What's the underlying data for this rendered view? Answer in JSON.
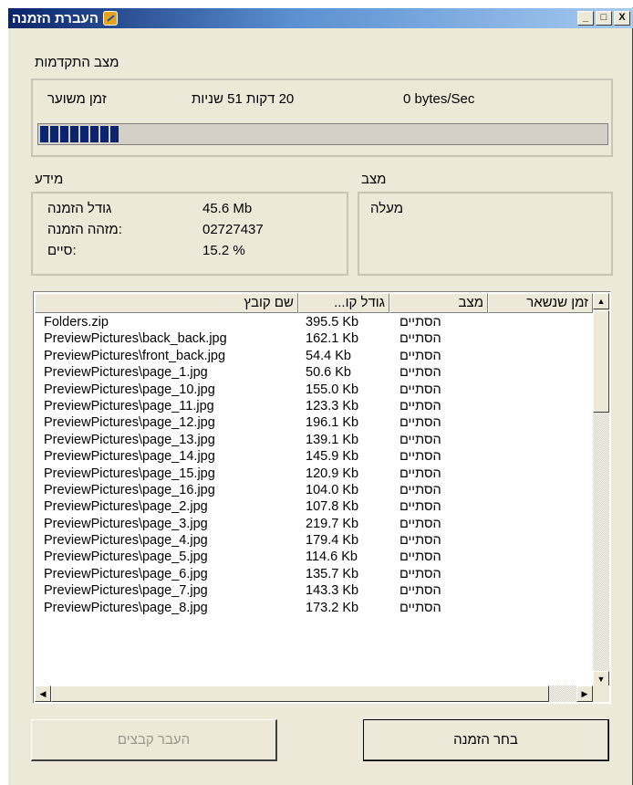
{
  "window": {
    "title": "העברת הזמנה",
    "caption_buttons": {
      "minimize": "_",
      "maximize": "□",
      "close": "X"
    }
  },
  "progress": {
    "section_label": "מצב התקדמות",
    "remaining_label": "זמן משוער",
    "remaining_value": "20 דקות 51 שניות",
    "speed": "0 bytes/Sec",
    "percent": 15.2
  },
  "info": {
    "section_label": "מידע",
    "fields": [
      {
        "label": "גודל הזמנה",
        "value": "45.6 Mb"
      },
      {
        "label": ":מזהה הזמנה",
        "value": "02727437"
      },
      {
        "label": ":סיים",
        "value": "15.2 %"
      }
    ]
  },
  "status": {
    "section_label": "מצב",
    "value": "מעלה"
  },
  "file_list": {
    "columns": [
      "שם קובץ",
      "גודל קו...",
      "מצב",
      "זמן שנשאר"
    ],
    "rows": [
      {
        "name": "Folders.zip",
        "size": "395.5 Kb",
        "status": "הסתיים"
      },
      {
        "name": "PreviewPictures\\back_back.jpg",
        "size": "162.1 Kb",
        "status": "הסתיים"
      },
      {
        "name": "PreviewPictures\\front_back.jpg",
        "size": "54.4 Kb",
        "status": "הסתיים"
      },
      {
        "name": "PreviewPictures\\page_1.jpg",
        "size": "50.6 Kb",
        "status": "הסתיים"
      },
      {
        "name": "PreviewPictures\\page_10.jpg",
        "size": "155.0 Kb",
        "status": "הסתיים"
      },
      {
        "name": "PreviewPictures\\page_11.jpg",
        "size": "123.3 Kb",
        "status": "הסתיים"
      },
      {
        "name": "PreviewPictures\\page_12.jpg",
        "size": "196.1 Kb",
        "status": "הסתיים"
      },
      {
        "name": "PreviewPictures\\page_13.jpg",
        "size": "139.1 Kb",
        "status": "הסתיים"
      },
      {
        "name": "PreviewPictures\\page_14.jpg",
        "size": "145.9 Kb",
        "status": "הסתיים"
      },
      {
        "name": "PreviewPictures\\page_15.jpg",
        "size": "120.9 Kb",
        "status": "הסתיים"
      },
      {
        "name": "PreviewPictures\\page_16.jpg",
        "size": "104.0 Kb",
        "status": "הסתיים"
      },
      {
        "name": "PreviewPictures\\page_2.jpg",
        "size": "107.8 Kb",
        "status": "הסתיים"
      },
      {
        "name": "PreviewPictures\\page_3.jpg",
        "size": "219.7 Kb",
        "status": "הסתיים"
      },
      {
        "name": "PreviewPictures\\page_4.jpg",
        "size": "179.4 Kb",
        "status": "הסתיים"
      },
      {
        "name": "PreviewPictures\\page_5.jpg",
        "size": "114.6 Kb",
        "status": "הסתיים"
      },
      {
        "name": "PreviewPictures\\page_6.jpg",
        "size": "135.7 Kb",
        "status": "הסתיים"
      },
      {
        "name": "PreviewPictures\\page_7.jpg",
        "size": "143.3 Kb",
        "status": "הסתיים"
      },
      {
        "name": "PreviewPictures\\page_8.jpg",
        "size": "173.2 Kb",
        "status": "הסתיים"
      }
    ]
  },
  "buttons": {
    "transfer_files": "העבר קבצים",
    "choose_order": "בחר הזמנה"
  },
  "icons": {
    "app": "app-transfer-icon",
    "scroll_up": "▲",
    "scroll_down": "▼",
    "scroll_left": "◀",
    "scroll_right": "▶"
  },
  "colors": {
    "progress_fill": "#0b2470",
    "window_bg": "#ece9d8"
  }
}
